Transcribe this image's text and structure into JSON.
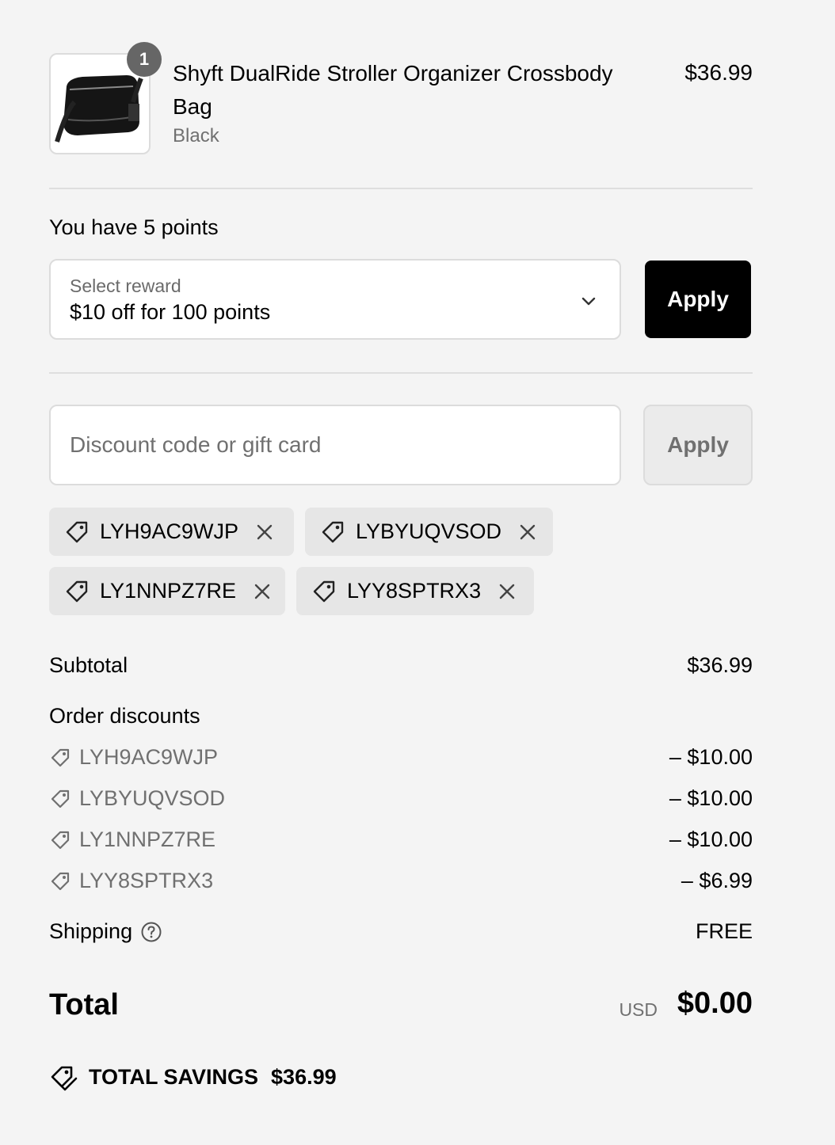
{
  "product": {
    "quantity": "1",
    "name": "Shyft DualRide Stroller Organizer Crossbody Bag",
    "variant": "Black",
    "price": "$36.99"
  },
  "rewards": {
    "points_text": "You have 5 points",
    "select_label": "Select reward",
    "select_value": "$10 off for 100 points",
    "apply_label": "Apply"
  },
  "discount": {
    "placeholder": "Discount code or gift card",
    "apply_label": "Apply",
    "applied_codes": [
      "LYH9AC9WJP",
      "LYBYUQVSOD",
      "LY1NNPZ7RE",
      "LYY8SPTRX3"
    ]
  },
  "summary": {
    "subtotal_label": "Subtotal",
    "subtotal_value": "$36.99",
    "order_discounts_label": "Order discounts",
    "discounts": [
      {
        "code": "LYH9AC9WJP",
        "amount": "– $10.00"
      },
      {
        "code": "LYBYUQVSOD",
        "amount": "– $10.00"
      },
      {
        "code": "LY1NNPZ7RE",
        "amount": "– $10.00"
      },
      {
        "code": "LYY8SPTRX3",
        "amount": "– $6.99"
      }
    ],
    "shipping_label": "Shipping",
    "shipping_value": "FREE",
    "total_label": "Total",
    "currency": "USD",
    "total_value": "$0.00",
    "savings_label": "TOTAL SAVINGS",
    "savings_value": "$36.99"
  }
}
